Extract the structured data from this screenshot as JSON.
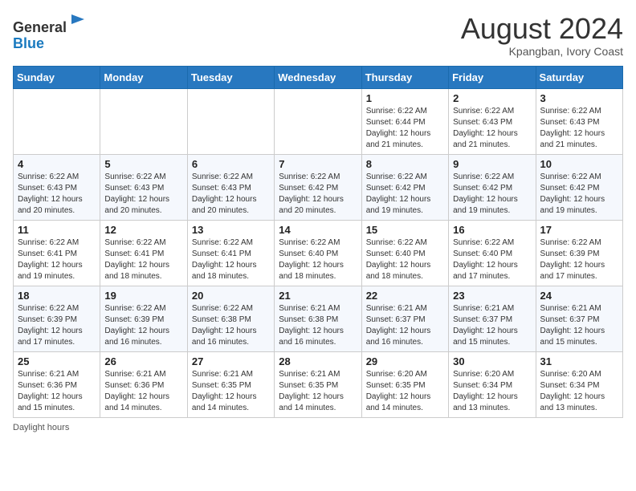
{
  "header": {
    "logo_general": "General",
    "logo_blue": "Blue",
    "month_year": "August 2024",
    "location": "Kpangban, Ivory Coast"
  },
  "days_of_week": [
    "Sunday",
    "Monday",
    "Tuesday",
    "Wednesday",
    "Thursday",
    "Friday",
    "Saturday"
  ],
  "weeks": [
    [
      {
        "day": "",
        "detail": ""
      },
      {
        "day": "",
        "detail": ""
      },
      {
        "day": "",
        "detail": ""
      },
      {
        "day": "",
        "detail": ""
      },
      {
        "day": "1",
        "detail": "Sunrise: 6:22 AM\nSunset: 6:44 PM\nDaylight: 12 hours\nand 21 minutes."
      },
      {
        "day": "2",
        "detail": "Sunrise: 6:22 AM\nSunset: 6:43 PM\nDaylight: 12 hours\nand 21 minutes."
      },
      {
        "day": "3",
        "detail": "Sunrise: 6:22 AM\nSunset: 6:43 PM\nDaylight: 12 hours\nand 21 minutes."
      }
    ],
    [
      {
        "day": "4",
        "detail": "Sunrise: 6:22 AM\nSunset: 6:43 PM\nDaylight: 12 hours\nand 20 minutes."
      },
      {
        "day": "5",
        "detail": "Sunrise: 6:22 AM\nSunset: 6:43 PM\nDaylight: 12 hours\nand 20 minutes."
      },
      {
        "day": "6",
        "detail": "Sunrise: 6:22 AM\nSunset: 6:43 PM\nDaylight: 12 hours\nand 20 minutes."
      },
      {
        "day": "7",
        "detail": "Sunrise: 6:22 AM\nSunset: 6:42 PM\nDaylight: 12 hours\nand 20 minutes."
      },
      {
        "day": "8",
        "detail": "Sunrise: 6:22 AM\nSunset: 6:42 PM\nDaylight: 12 hours\nand 19 minutes."
      },
      {
        "day": "9",
        "detail": "Sunrise: 6:22 AM\nSunset: 6:42 PM\nDaylight: 12 hours\nand 19 minutes."
      },
      {
        "day": "10",
        "detail": "Sunrise: 6:22 AM\nSunset: 6:42 PM\nDaylight: 12 hours\nand 19 minutes."
      }
    ],
    [
      {
        "day": "11",
        "detail": "Sunrise: 6:22 AM\nSunset: 6:41 PM\nDaylight: 12 hours\nand 19 minutes."
      },
      {
        "day": "12",
        "detail": "Sunrise: 6:22 AM\nSunset: 6:41 PM\nDaylight: 12 hours\nand 18 minutes."
      },
      {
        "day": "13",
        "detail": "Sunrise: 6:22 AM\nSunset: 6:41 PM\nDaylight: 12 hours\nand 18 minutes."
      },
      {
        "day": "14",
        "detail": "Sunrise: 6:22 AM\nSunset: 6:40 PM\nDaylight: 12 hours\nand 18 minutes."
      },
      {
        "day": "15",
        "detail": "Sunrise: 6:22 AM\nSunset: 6:40 PM\nDaylight: 12 hours\nand 18 minutes."
      },
      {
        "day": "16",
        "detail": "Sunrise: 6:22 AM\nSunset: 6:40 PM\nDaylight: 12 hours\nand 17 minutes."
      },
      {
        "day": "17",
        "detail": "Sunrise: 6:22 AM\nSunset: 6:39 PM\nDaylight: 12 hours\nand 17 minutes."
      }
    ],
    [
      {
        "day": "18",
        "detail": "Sunrise: 6:22 AM\nSunset: 6:39 PM\nDaylight: 12 hours\nand 17 minutes."
      },
      {
        "day": "19",
        "detail": "Sunrise: 6:22 AM\nSunset: 6:39 PM\nDaylight: 12 hours\nand 16 minutes."
      },
      {
        "day": "20",
        "detail": "Sunrise: 6:22 AM\nSunset: 6:38 PM\nDaylight: 12 hours\nand 16 minutes."
      },
      {
        "day": "21",
        "detail": "Sunrise: 6:21 AM\nSunset: 6:38 PM\nDaylight: 12 hours\nand 16 minutes."
      },
      {
        "day": "22",
        "detail": "Sunrise: 6:21 AM\nSunset: 6:37 PM\nDaylight: 12 hours\nand 16 minutes."
      },
      {
        "day": "23",
        "detail": "Sunrise: 6:21 AM\nSunset: 6:37 PM\nDaylight: 12 hours\nand 15 minutes."
      },
      {
        "day": "24",
        "detail": "Sunrise: 6:21 AM\nSunset: 6:37 PM\nDaylight: 12 hours\nand 15 minutes."
      }
    ],
    [
      {
        "day": "25",
        "detail": "Sunrise: 6:21 AM\nSunset: 6:36 PM\nDaylight: 12 hours\nand 15 minutes."
      },
      {
        "day": "26",
        "detail": "Sunrise: 6:21 AM\nSunset: 6:36 PM\nDaylight: 12 hours\nand 14 minutes."
      },
      {
        "day": "27",
        "detail": "Sunrise: 6:21 AM\nSunset: 6:35 PM\nDaylight: 12 hours\nand 14 minutes."
      },
      {
        "day": "28",
        "detail": "Sunrise: 6:21 AM\nSunset: 6:35 PM\nDaylight: 12 hours\nand 14 minutes."
      },
      {
        "day": "29",
        "detail": "Sunrise: 6:20 AM\nSunset: 6:35 PM\nDaylight: 12 hours\nand 14 minutes."
      },
      {
        "day": "30",
        "detail": "Sunrise: 6:20 AM\nSunset: 6:34 PM\nDaylight: 12 hours\nand 13 minutes."
      },
      {
        "day": "31",
        "detail": "Sunrise: 6:20 AM\nSunset: 6:34 PM\nDaylight: 12 hours\nand 13 minutes."
      }
    ]
  ],
  "legend": {
    "daylight_hours": "Daylight hours"
  }
}
